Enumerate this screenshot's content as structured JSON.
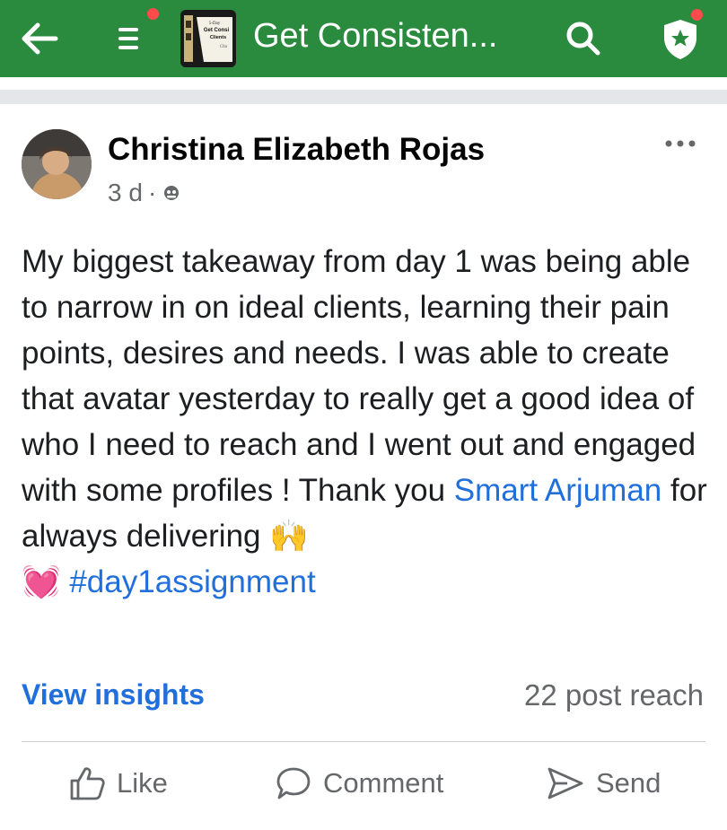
{
  "header": {
    "title": "Get Consisten...",
    "thumbnail_text": [
      "5-Day",
      "Get Consi",
      "Clients",
      "Cha"
    ],
    "icons": [
      "back-arrow-icon",
      "menu-icon",
      "search-icon",
      "shield-star-icon"
    ],
    "colors": {
      "bar": "#2a8a3e",
      "notification_dot": "#ff4b4b"
    }
  },
  "post": {
    "author": "Christina Elizabeth Rojas",
    "time": "3 d",
    "separator": "·",
    "privacy_icon": "group-icon",
    "text_before_mention": "My biggest takeaway from day 1 was being able to narrow in on ideal clients, learning their pain points, desires and needs. I was able to create that avatar yesterday to really get a good idea of who I need to reach and I went out and engaged with some profiles ! Thank you ",
    "mention": "Smart Arjuman",
    "text_after_mention": " for always delivering ",
    "emoji_hands": "🙌",
    "emoji_heart": "💓",
    "hashtag": "#day1assignment",
    "view_insights": "View insights",
    "reach": "22 post reach"
  },
  "actions": [
    {
      "label": "Like",
      "icon": "thumbs-up-icon"
    },
    {
      "label": "Comment",
      "icon": "comment-icon"
    },
    {
      "label": "Send",
      "icon": "send-icon"
    }
  ],
  "colors": {
    "link": "#216fdb",
    "secondary_text": "#65676b"
  }
}
